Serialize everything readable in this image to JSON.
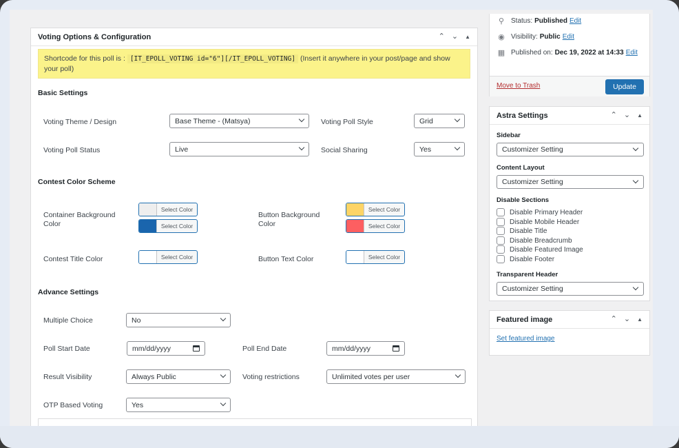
{
  "main": {
    "title": "Voting Options & Configuration",
    "shortcode": {
      "prefix": "Shortcode for this poll is :",
      "code": "[IT_EPOLL_VOTING id=\"6\"][/IT_EPOLL_VOTING]",
      "suffix": "(Insert it anywhere in your post/page and show your poll)"
    },
    "basic": {
      "title": "Basic Settings",
      "theme_label": "Voting Theme / Design",
      "theme_value": "Base Theme - (Matsya)",
      "style_label": "Voting Poll Style",
      "style_value": "Grid",
      "status_label": "Voting Poll Status",
      "status_value": "Live",
      "social_label": "Social Sharing",
      "social_value": "Yes"
    },
    "colors": {
      "title": "Contest Color Scheme",
      "select_label": "Select Color",
      "container_bg_label": "Container Background Color",
      "container_bg_1": "#eeeeee",
      "container_bg_2": "#1a65ad",
      "button_bg_label": "Button Background Color",
      "button_bg_1": "#fdd466",
      "button_bg_2": "#fd5f61",
      "contest_title_label": "Contest Title Color",
      "contest_title_color": "#ffffff",
      "button_text_label": "Button Text Color",
      "button_text_color": "#ffffff"
    },
    "advance": {
      "title": "Advance Settings",
      "multiple_label": "Multiple Choice",
      "multiple_value": "No",
      "start_label": "Poll Start Date",
      "start_placeholder": "mm/dd/yyyy",
      "end_label": "Poll End Date",
      "end_placeholder": "mm/dd/yyyy",
      "result_label": "Result Visibility",
      "result_value": "Always Public",
      "restrict_label": "Voting restrictions",
      "restrict_value": "Unlimited votes per user",
      "otp_label": "OTP Based Voting",
      "otp_value": "Yes"
    }
  },
  "publish": {
    "status_label": "Status:",
    "status_value": "Published",
    "visibility_label": "Visibility:",
    "visibility_value": "Public",
    "published_label": "Published on:",
    "published_value": "Dec 19, 2022 at 14:33",
    "edit_label": "Edit",
    "trash_label": "Move to Trash",
    "update_label": "Update"
  },
  "astra": {
    "title": "Astra Settings",
    "sidebar_label": "Sidebar",
    "sidebar_value": "Customizer Setting",
    "layout_label": "Content Layout",
    "layout_value": "Customizer Setting",
    "disable_label": "Disable Sections",
    "disable_items": [
      "Disable Primary Header",
      "Disable Mobile Header",
      "Disable Title",
      "Disable Breadcrumb",
      "Disable Featured Image",
      "Disable Footer"
    ],
    "transparent_label": "Transparent Header",
    "transparent_value": "Customizer Setting"
  },
  "featured": {
    "title": "Featured image",
    "link": "Set featured image"
  },
  "icons": {
    "up": "⌃",
    "down": "⌄",
    "toggle": "▲",
    "pin": "📍",
    "eye": "👁",
    "calendar": "📅"
  }
}
